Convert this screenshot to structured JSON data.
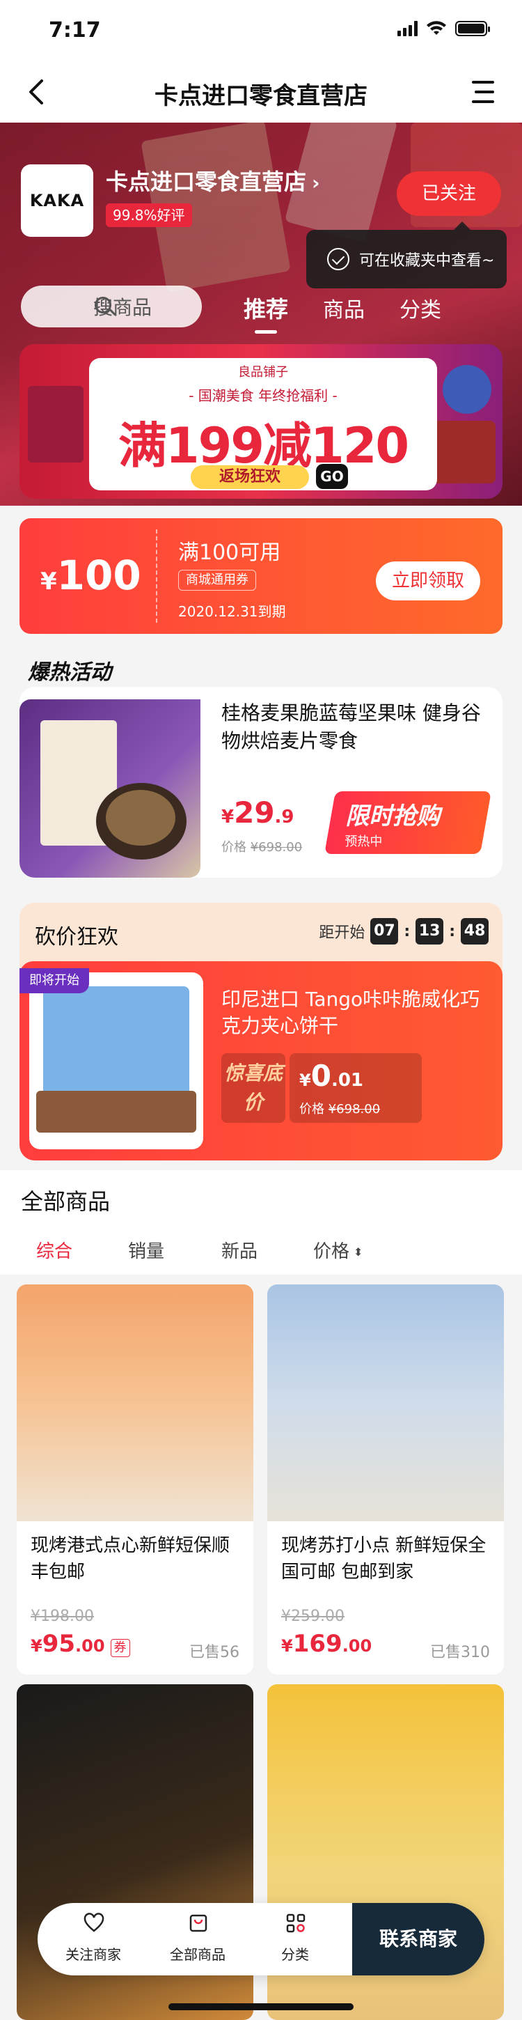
{
  "status_bar": {
    "time": "7:17"
  },
  "nav": {
    "title": "卡点进口零食直营店"
  },
  "shop": {
    "logo_text": "KAKA",
    "name": "卡点进口零食直营店",
    "chevron": "›",
    "rating": "99.8%好评",
    "follow_label": "已关注",
    "tooltip": "可在收藏夹中查看~"
  },
  "search": {
    "placeholder": "搜商品"
  },
  "tabs": [
    "推荐",
    "商品",
    "分类"
  ],
  "banner": {
    "brand": "良品铺子",
    "subtitle": "- 国潮美食 年终抢福利 -",
    "headline": "满199减120",
    "pill": "返场狂欢",
    "go": "GO"
  },
  "coupon": {
    "symbol": "¥",
    "amount": "100",
    "condition": "满100可用",
    "tag": "商城通用券",
    "expiry": "2020.12.31到期",
    "claim_label": "立即领取"
  },
  "hot_section": {
    "title": "爆热活动",
    "product": {
      "name": "桂格麦果脆蓝莓坚果味 健身谷物烘焙麦片零食",
      "price_symbol": "¥",
      "price_int": "29",
      "price_dec": ".9",
      "orig_label": "价格",
      "orig_price": "¥698.00",
      "flash_label": "限时抢购",
      "flash_sub": "预热中"
    }
  },
  "bargain": {
    "title": "砍价狂欢",
    "countdown_label": "距开始",
    "countdown": [
      "07",
      "13",
      "48"
    ],
    "badge": "即将开始",
    "product": {
      "name": "印尼进口 Tango咔咔脆威化巧克力夹心饼干",
      "surprise_label": "惊喜底价",
      "price_symbol": "¥",
      "price_int": "0",
      "price_dec": ".01",
      "orig_label": "价格",
      "orig_price": "¥698.00"
    }
  },
  "all_products": {
    "title": "全部商品",
    "sorts": [
      "综合",
      "销量",
      "新品",
      "价格"
    ],
    "sort_arrow": "⬍",
    "items": [
      {
        "name": "现烤港式点心新鲜短保顺丰包邮",
        "orig": "¥198.00",
        "symbol": "¥",
        "price_int": "95",
        "price_dec": ".00",
        "coupon": "券",
        "sold": "已售56"
      },
      {
        "name": "现烤苏打小点 新鲜短保全国可邮 包邮到家",
        "orig": "¥259.00",
        "symbol": "¥",
        "price_int": "169",
        "price_dec": ".00",
        "coupon": "",
        "sold": "已售310"
      },
      {
        "name": "",
        "orig": "",
        "symbol": "",
        "price_int": "",
        "price_dec": "",
        "coupon": "",
        "sold": ""
      },
      {
        "name": "",
        "orig": "",
        "symbol": "",
        "price_int": "",
        "price_dec": "",
        "coupon": "",
        "sold": ""
      }
    ]
  },
  "bottom_bar": {
    "follow": "关注商家",
    "all": "全部商品",
    "category": "分类",
    "contact": "联系商家"
  },
  "colors": {
    "accent": "#e8273d",
    "coupon": "#ff3d3d",
    "dark": "#172a3a"
  }
}
